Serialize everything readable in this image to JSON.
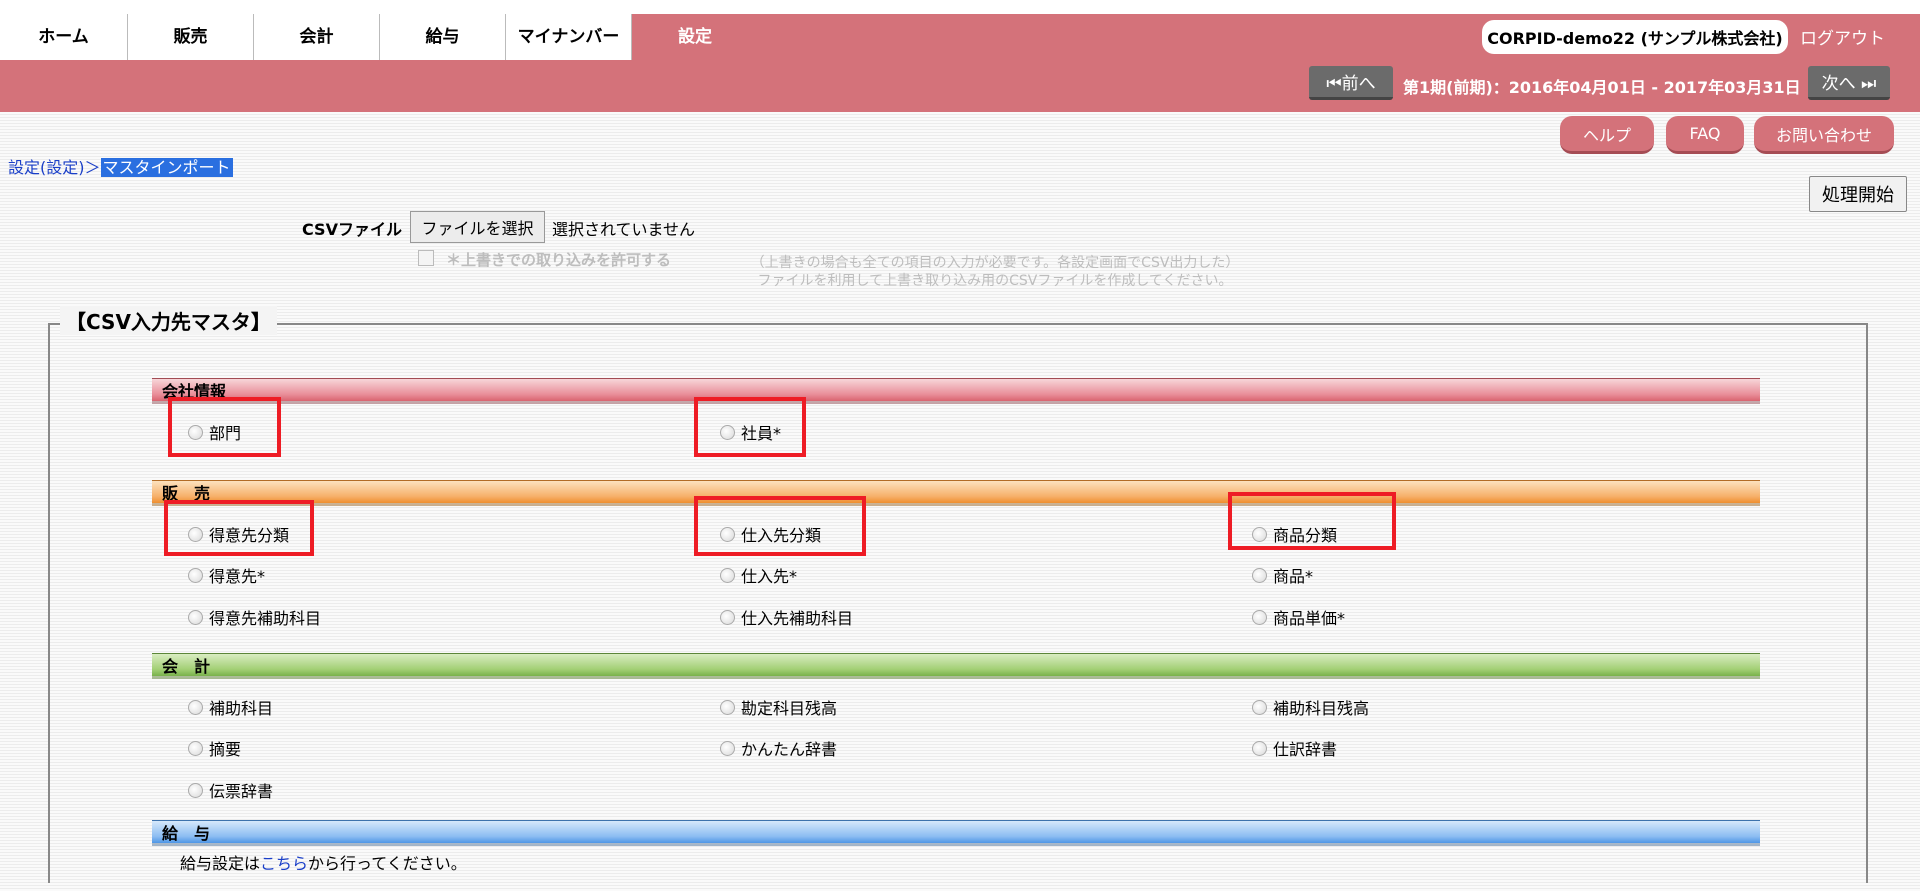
{
  "nav": {
    "tabs": [
      "ホーム",
      "販売",
      "会計",
      "給与",
      "マイナンバー",
      "設定"
    ],
    "active": "設定"
  },
  "header": {
    "company": "CORPID-demo22 (サンプル株式会社)",
    "logout": "ログアウト",
    "prev": "⏮前へ",
    "period": "第1期(前期)：2016年04月01日 - 2017年03月31日",
    "next": "次へ ⏭",
    "help": "ヘルプ",
    "faq": "FAQ",
    "contact": "お問い合わせ"
  },
  "breadcrumb": {
    "parent": "設定(設定)",
    "separator": "＞",
    "current": "マスタインポート"
  },
  "form": {
    "start_button": "処理開始",
    "csv_label": "CSVファイル",
    "file_button": "ファイルを選択",
    "no_file": "選択されていません",
    "overwrite_label": "＊上書きでの取り込みを許可する",
    "note_line1": "（上書きの場合も全ての項目の入力が必要です。各設定画面でCSV出力した）",
    "note_line2": "ファイルを利用して上書き取り込み用のCSVファイルを作成してください。"
  },
  "master": {
    "legend": "【CSV入力先マスタ】",
    "sections": {
      "kaisha": {
        "title": "会社情報",
        "items": [
          "部門",
          "社員*"
        ]
      },
      "hanbai": {
        "title": "販　売",
        "items": [
          "得意先分類",
          "仕入先分類",
          "商品分類",
          "得意先*",
          "仕入先*",
          "商品*",
          "得意先補助科目",
          "仕入先補助科目",
          "商品単価*"
        ]
      },
      "kaikei": {
        "title": "会　計",
        "items": [
          "補助科目",
          "勘定科目残高",
          "補助科目残高",
          "摘要",
          "かんたん辞書",
          "仕訳辞書",
          "伝票辞書"
        ]
      },
      "kyuyo": {
        "title": "給　与",
        "text_before": "給与設定は",
        "link": "こちら",
        "text_after": "から行ってください。"
      }
    }
  },
  "colors": {
    "header_bg": "#d4727a",
    "highlight_box": "#ee1c25",
    "link": "#1a3fc8"
  }
}
